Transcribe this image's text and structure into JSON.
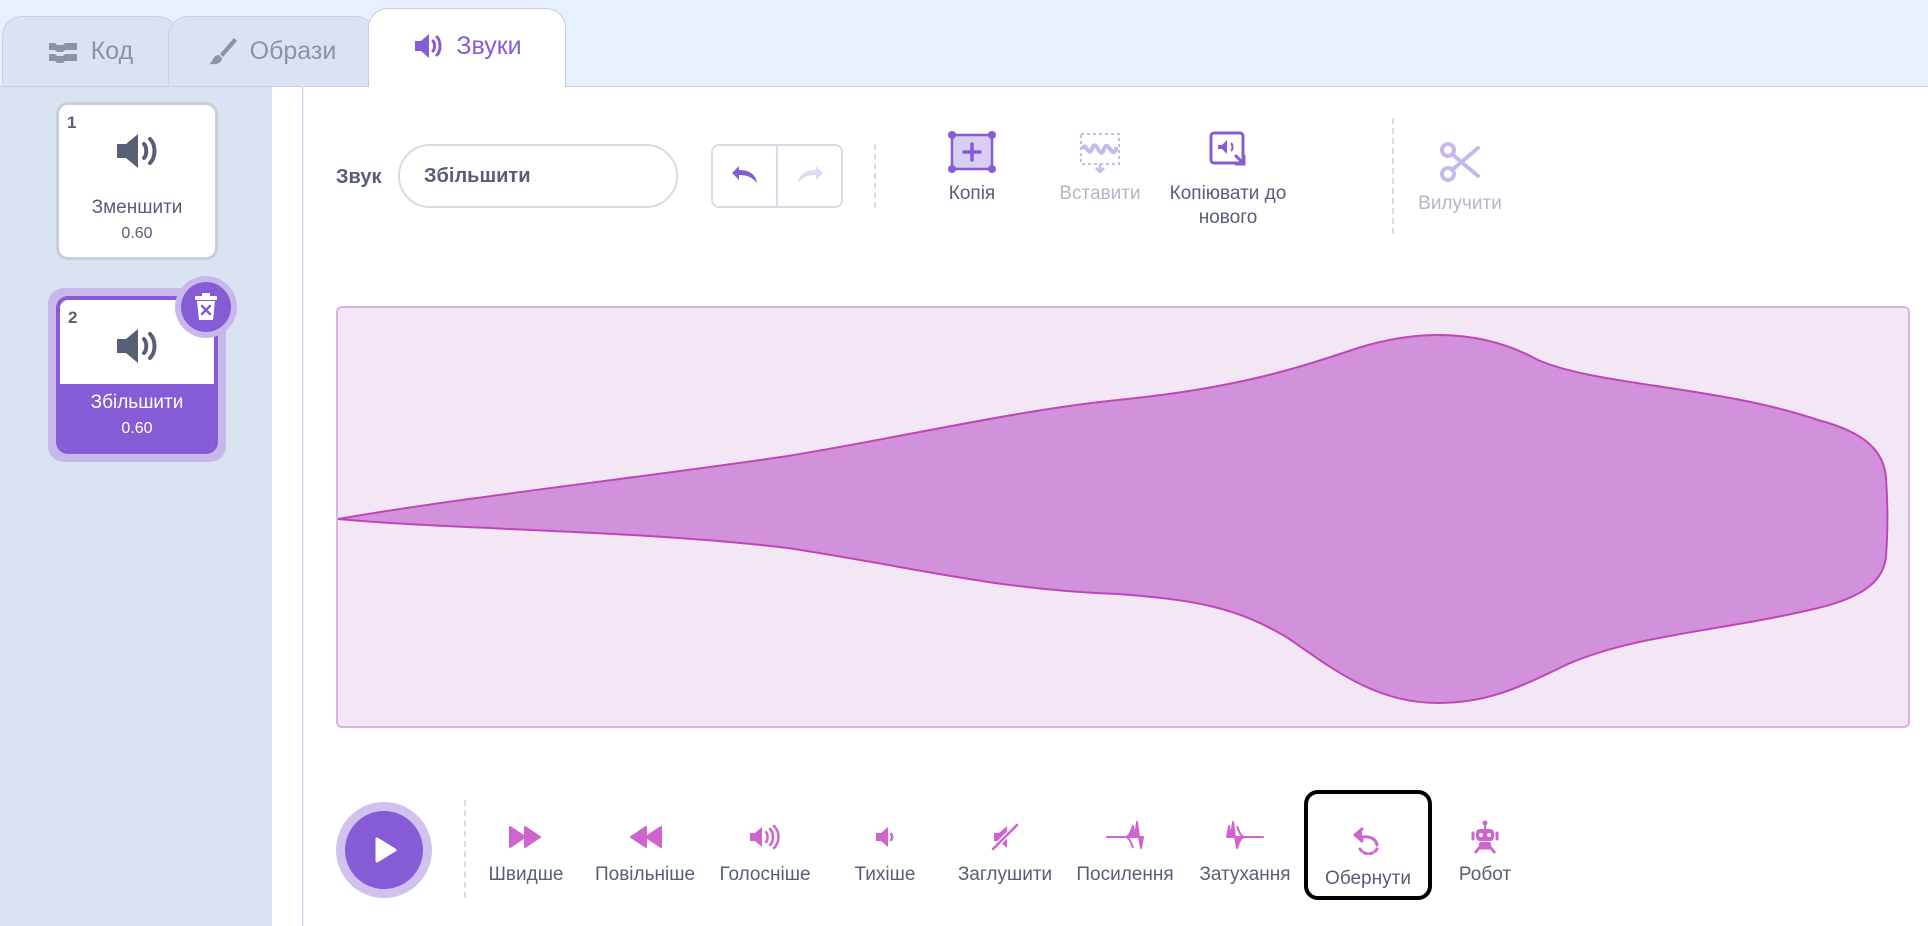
{
  "tabs": {
    "code": "Код",
    "costumes": "Образи",
    "sounds": "Звуки"
  },
  "sounds_list": [
    {
      "number": "1",
      "name": "Зменшити",
      "duration": "0.60",
      "selected": false
    },
    {
      "number": "2",
      "name": "Збільшити",
      "duration": "0.60",
      "selected": true
    }
  ],
  "editor": {
    "sound_label": "Звук",
    "sound_name": "Збільшити"
  },
  "toolbar": {
    "copy": "Копія",
    "paste": "Вставити",
    "copy_to_new_line1": "Копіювати до",
    "copy_to_new_line2": "нового",
    "delete": "Вилучити"
  },
  "effects": {
    "faster": "Швидше",
    "slower": "Повільніше",
    "louder": "Голосніше",
    "softer": "Тихіше",
    "mute": "Заглушити",
    "fade_in": "Посилення",
    "fade_out": "Затухання",
    "reverse": "Обернути",
    "robot": "Робот"
  },
  "colors": {
    "accent": "#855cd6",
    "sound_pink": "#cf63cf",
    "wave_fill": "#d291db",
    "wave_bg": "#f3e7f6",
    "selected_outline": "#000000"
  },
  "icons": {
    "code_tab": "code-blocks-icon",
    "costumes_tab": "paintbrush-icon",
    "sounds_tab": "speaker-icon",
    "undo": "undo-icon",
    "redo": "redo-icon",
    "copy": "copy-icon",
    "paste": "paste-icon",
    "copy_to_new": "copy-to-new-icon",
    "delete_tool": "scissors-icon",
    "play": "play-icon",
    "delete_sound": "trash-icon"
  }
}
